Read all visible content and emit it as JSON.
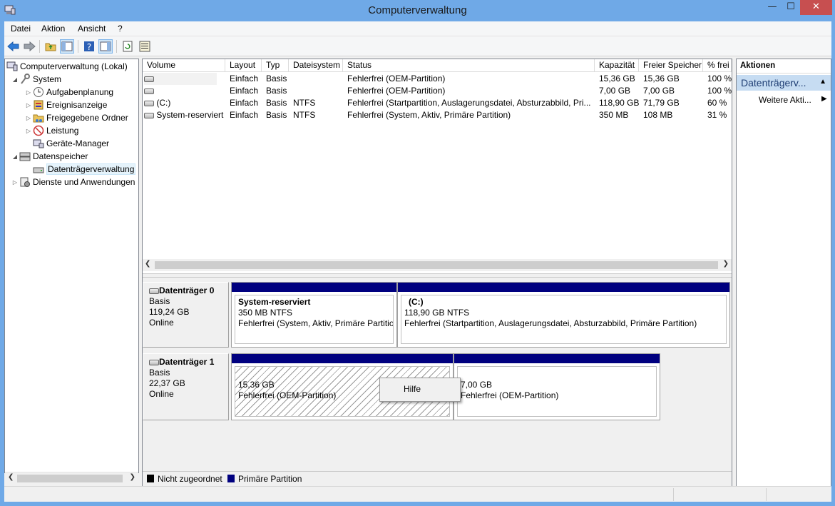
{
  "window": {
    "title": "Computerverwaltung",
    "minimize": "—",
    "maximize": "☐",
    "close": "✕"
  },
  "menu": [
    "Datei",
    "Aktion",
    "Ansicht",
    "?"
  ],
  "tree": {
    "root": "Computerverwaltung (Lokal)",
    "system": "System",
    "items": [
      "Aufgabenplanung",
      "Ereignisanzeige",
      "Freigegebene Ordner",
      "Leistung",
      "Geräte-Manager"
    ],
    "storage": "Datenspeicher",
    "diskmgmt": "Datenträgerverwaltung",
    "services": "Dienste und Anwendungen"
  },
  "volumes": {
    "columns": [
      "Volume",
      "Layout",
      "Typ",
      "Dateisystem",
      "Status",
      "Kapazität",
      "Freier Speicher",
      "% frei"
    ],
    "rows": [
      {
        "volume": "",
        "layout": "Einfach",
        "typ": "Basis",
        "fs": "",
        "status": "Fehlerfrei (OEM-Partition)",
        "cap": "15,36 GB",
        "free": "15,36 GB",
        "pct": "100 %"
      },
      {
        "volume": "",
        "layout": "Einfach",
        "typ": "Basis",
        "fs": "",
        "status": "Fehlerfrei (OEM-Partition)",
        "cap": "7,00 GB",
        "free": "7,00 GB",
        "pct": "100 %"
      },
      {
        "volume": "(C:)",
        "layout": "Einfach",
        "typ": "Basis",
        "fs": "NTFS",
        "status": "Fehlerfrei (Startpartition, Auslagerungsdatei, Absturzabbild, Pri...",
        "cap": "118,90 GB",
        "free": "71,79 GB",
        "pct": "60 %"
      },
      {
        "volume": "System-reserviert",
        "layout": "Einfach",
        "typ": "Basis",
        "fs": "NTFS",
        "status": "Fehlerfrei (System, Aktiv, Primäre Partition)",
        "cap": "350 MB",
        "free": "108 MB",
        "pct": "31 %"
      }
    ]
  },
  "disk0": {
    "name": "Datenträger 0",
    "type": "Basis",
    "size": "119,24 GB",
    "state": "Online",
    "p1": {
      "title": "System-reserviert",
      "size": "350 MB NTFS",
      "status": "Fehlerfrei (System, Aktiv, Primäre Partition)"
    },
    "p2": {
      "title": "(C:)",
      "size": "118,90 GB NTFS",
      "status": "Fehlerfrei (Startpartition, Auslagerungsdatei, Absturzabbild, Primäre Partition)"
    }
  },
  "disk1": {
    "name": "Datenträger 1",
    "type": "Basis",
    "size": "22,37 GB",
    "state": "Online",
    "p1": {
      "size": "15,36 GB",
      "status": "Fehlerfrei (OEM-Partition)"
    },
    "p2": {
      "size": "7,00 GB",
      "status": "Fehlerfrei (OEM-Partition)"
    }
  },
  "legend": {
    "unallocated": "Nicht zugeordnet",
    "primary": "Primäre Partition"
  },
  "actions": {
    "header": "Aktionen",
    "section": "Datenträgerv...",
    "more": "Weitere Akti..."
  },
  "context_menu": {
    "help": "Hilfe"
  },
  "colors": {
    "primary_partition": "#00007f",
    "unallocated": "#000000",
    "titlebar": "#6fa9e7",
    "close": "#c74f50"
  }
}
